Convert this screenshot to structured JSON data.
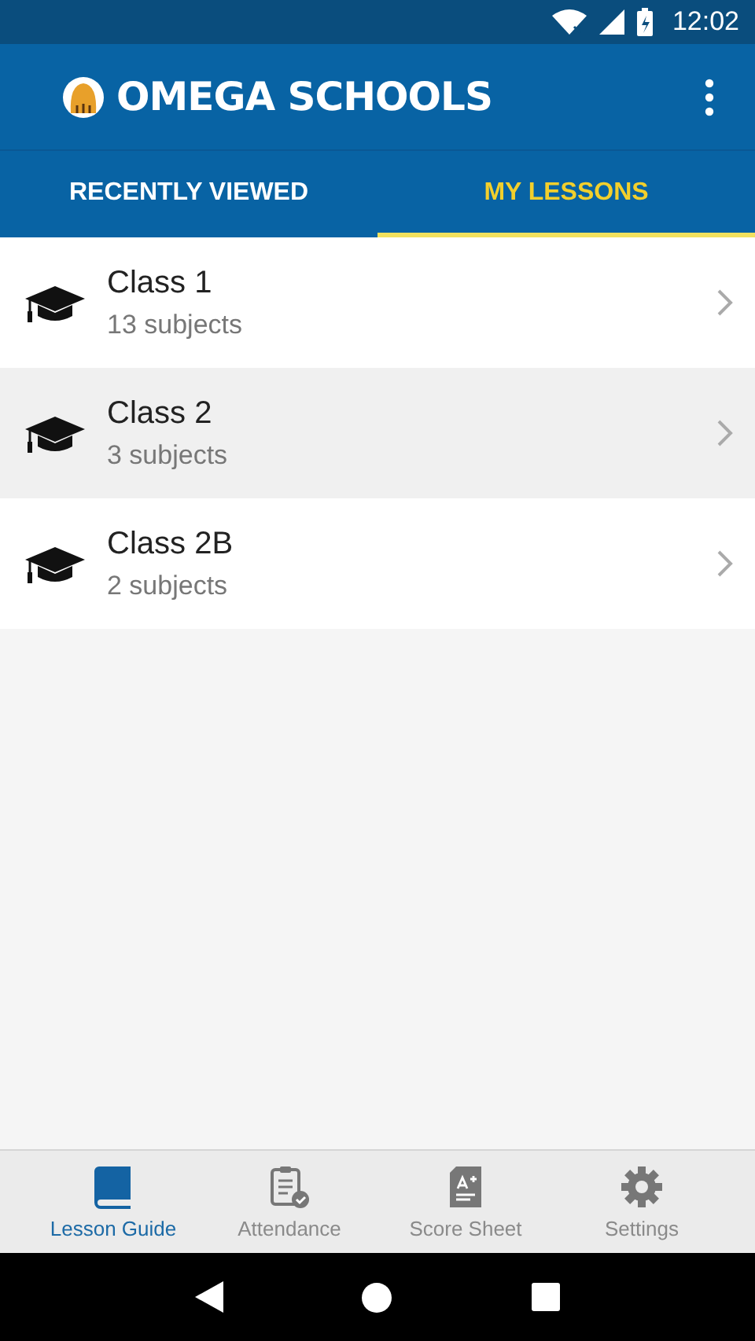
{
  "status_bar": {
    "time": "12:02"
  },
  "app_bar": {
    "title": "OMEGA SCHOOLS"
  },
  "tabs": [
    {
      "label": "RECENTLY VIEWED",
      "selected": false
    },
    {
      "label": "MY LESSONS",
      "selected": true
    }
  ],
  "classes": [
    {
      "name": "Class 1",
      "subjects": "13 subjects"
    },
    {
      "name": "Class 2",
      "subjects": "3 subjects"
    },
    {
      "name": "Class 2B",
      "subjects": "2 subjects"
    }
  ],
  "bottom_nav": [
    {
      "kind": "book",
      "label": "Lesson Guide",
      "selected": true
    },
    {
      "kind": "clipboard",
      "label": "Attendance",
      "selected": false
    },
    {
      "kind": "sheet",
      "label": "Score Sheet",
      "selected": false
    },
    {
      "kind": "gear",
      "label": "Settings",
      "selected": false
    }
  ]
}
